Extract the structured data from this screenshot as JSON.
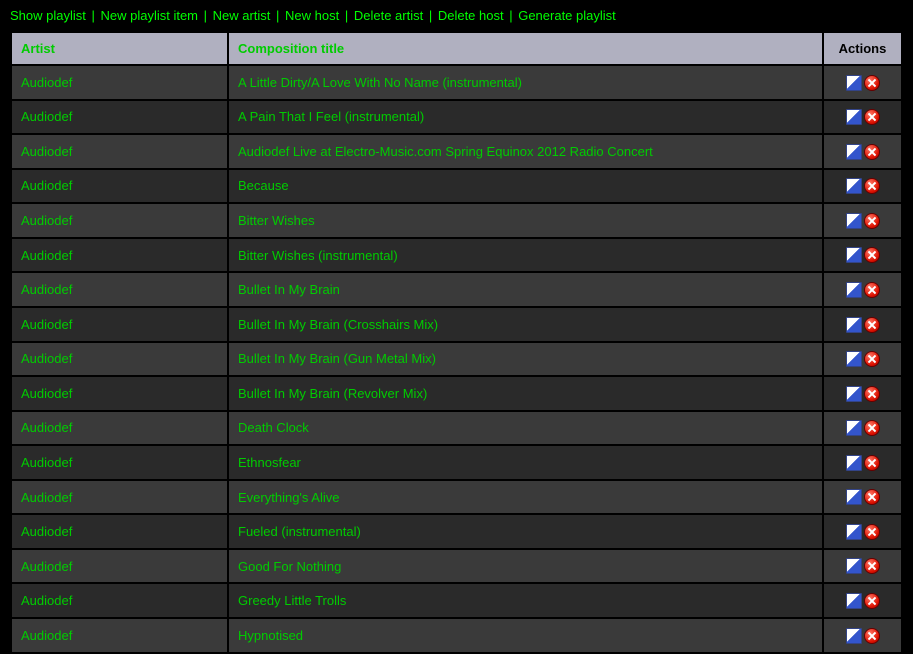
{
  "nav": {
    "show_playlist": "Show playlist",
    "new_playlist_item": "New playlist item",
    "new_artist": "New artist",
    "new_host": "New host",
    "delete_artist": "Delete artist",
    "delete_host": "Delete host",
    "generate_playlist": "Generate playlist",
    "separator": " | "
  },
  "table": {
    "headers": {
      "artist": "Artist",
      "title": "Composition title",
      "actions": "Actions"
    },
    "rows": [
      {
        "artist": "Audiodef",
        "title": "A Little Dirty/A Love With No Name (instrumental)"
      },
      {
        "artist": "Audiodef",
        "title": "A Pain That I Feel (instrumental)"
      },
      {
        "artist": "Audiodef",
        "title": "Audiodef Live at Electro-Music.com Spring Equinox 2012 Radio Concert"
      },
      {
        "artist": "Audiodef",
        "title": "Because"
      },
      {
        "artist": "Audiodef",
        "title": "Bitter Wishes"
      },
      {
        "artist": "Audiodef",
        "title": "Bitter Wishes (instrumental)"
      },
      {
        "artist": "Audiodef",
        "title": "Bullet In My Brain"
      },
      {
        "artist": "Audiodef",
        "title": "Bullet In My Brain (Crosshairs Mix)"
      },
      {
        "artist": "Audiodef",
        "title": "Bullet In My Brain (Gun Metal Mix)"
      },
      {
        "artist": "Audiodef",
        "title": "Bullet In My Brain (Revolver Mix)"
      },
      {
        "artist": "Audiodef",
        "title": "Death Clock"
      },
      {
        "artist": "Audiodef",
        "title": "Ethnosfear"
      },
      {
        "artist": "Audiodef",
        "title": "Everything's Alive"
      },
      {
        "artist": "Audiodef",
        "title": "Fueled (instrumental)"
      },
      {
        "artist": "Audiodef",
        "title": "Good For Nothing"
      },
      {
        "artist": "Audiodef",
        "title": "Greedy Little Trolls"
      },
      {
        "artist": "Audiodef",
        "title": "Hypnotised"
      }
    ]
  }
}
